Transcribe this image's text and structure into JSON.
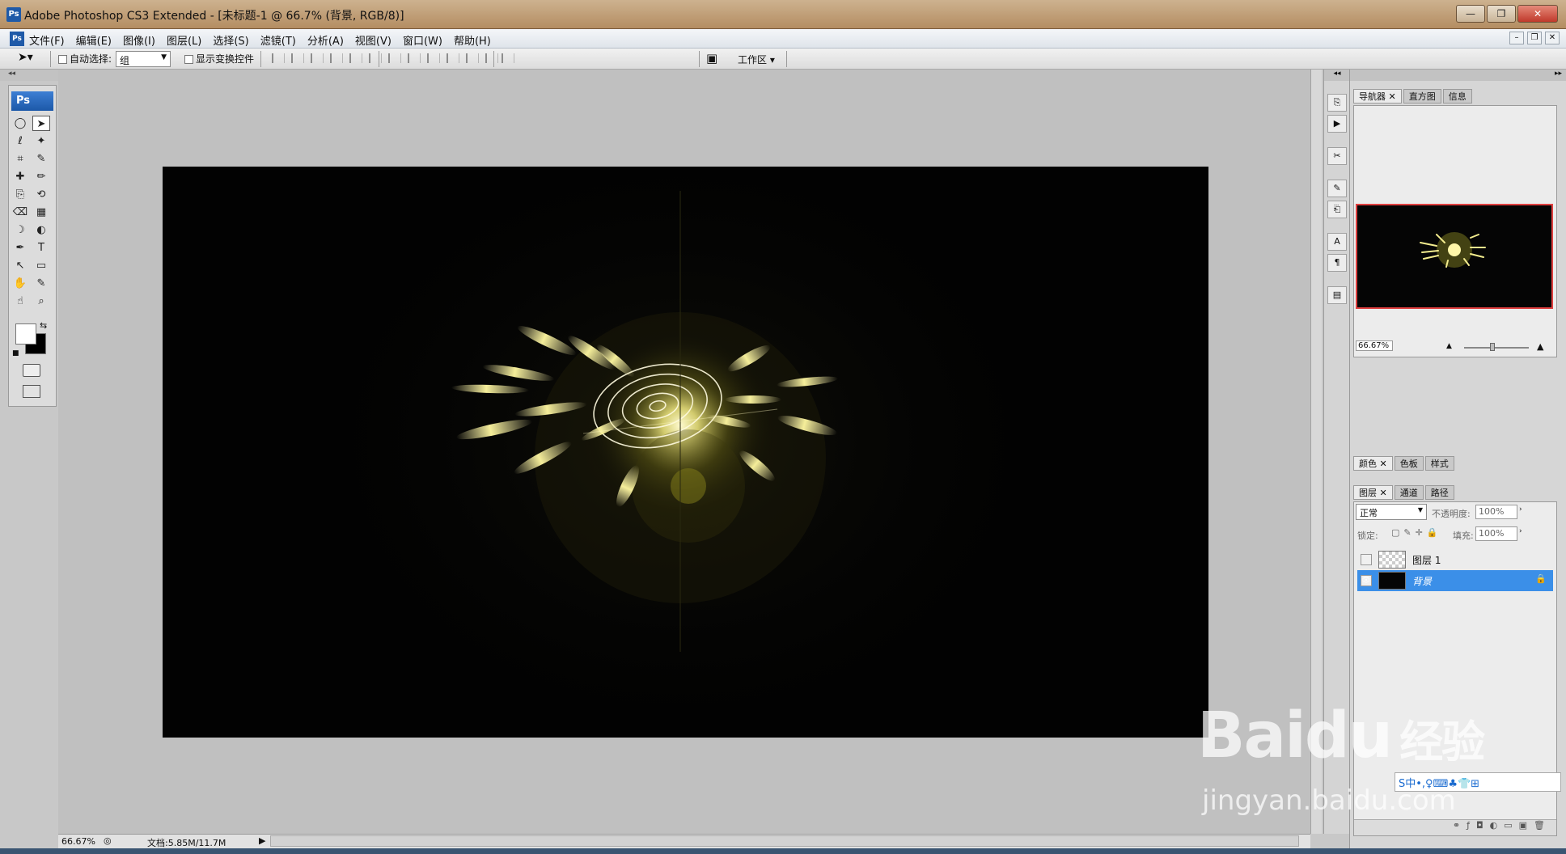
{
  "window": {
    "title": "Adobe Photoshop CS3 Extended - [未标题-1 @ 66.7% (背景, RGB/8)]",
    "app_icon": "Ps",
    "buttons": [
      "—",
      "❐",
      "✕"
    ]
  },
  "menu": {
    "items": [
      "文件(F)",
      "编辑(E)",
      "图像(I)",
      "图层(L)",
      "选择(S)",
      "滤镜(T)",
      "分析(A)",
      "视图(V)",
      "窗口(W)",
      "帮助(H)"
    ],
    "mdi_buttons": [
      "–",
      "❐",
      "✕"
    ]
  },
  "options": {
    "auto_select_label": "自动选择:",
    "auto_select_value": "组",
    "show_transform_label": "显示变换控件",
    "workspace_label": "工作区 ▾"
  },
  "toolbox": {
    "logo": "Ps",
    "tools": [
      "◯",
      "➤",
      "ℓ",
      "✦",
      "⌗",
      "✎",
      "✚",
      "✏",
      "⎘",
      "⟲",
      "⌫",
      "▦",
      "☽",
      "◐",
      "✒",
      "T",
      "↖",
      "▭",
      "✋",
      "✎",
      "☝",
      "⌕"
    ]
  },
  "canvas": {
    "background": "#c0c0c0",
    "document_color": "#020202",
    "glow_color": "#e8e07a"
  },
  "status": {
    "zoom": "66.67%",
    "doc_info": "文档:5.85M/11.7M"
  },
  "panels": {
    "navigator_tabs": [
      "导航器",
      "直方图",
      "信息"
    ],
    "navigator_zoom": "66.67%",
    "color_tabs": [
      "颜色",
      "色板",
      "样式"
    ],
    "layers_tabs": [
      "图层",
      "通道",
      "路径"
    ],
    "blend_mode": "正常",
    "opacity_label": "不透明度:",
    "opacity_value": "100%",
    "lock_label": "锁定:",
    "fill_label": "填充:",
    "fill_value": "100%",
    "layers": [
      {
        "name": "图层 1",
        "visible": false
      },
      {
        "name": "背景",
        "visible": true,
        "selected": true
      }
    ]
  },
  "watermark": {
    "brand": "Baidu",
    "brand_cn": "经验",
    "url": "jingyan.baidu.com",
    "ime": "S中•,♀⌨♣👕⊞"
  }
}
